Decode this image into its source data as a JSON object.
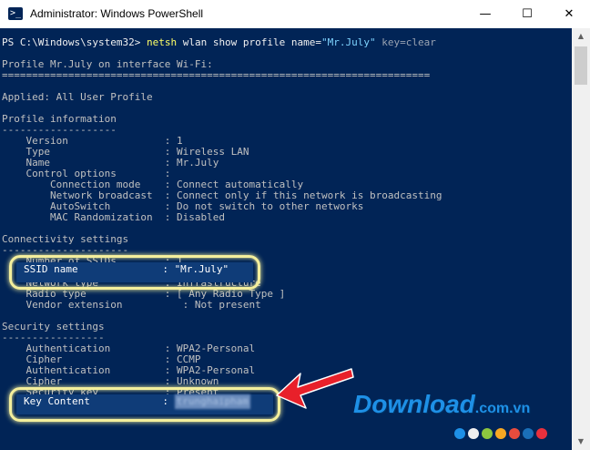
{
  "window": {
    "title": "Administrator: Windows PowerShell",
    "icon": "powershell-icon",
    "controls": {
      "minimize": "—",
      "maximize": "☐",
      "close": "✕"
    }
  },
  "console": {
    "prompt": "PS C:\\Windows\\system32>",
    "command": "netsh",
    "args": "wlan show profile name=",
    "arg_value": "\"Mr.July\"",
    "arg_tail": "key=clear",
    "lines": [
      "Profile Mr.July on interface Wi-Fi:",
      "=======================================================================",
      "Applied: All User Profile",
      "Profile information",
      "-------------------",
      "    Version                : 1",
      "    Type                   : Wireless LAN",
      "    Name                   : Mr.July",
      "    Control options        :",
      "        Connection mode    : Connect automatically",
      "        Network broadcast  : Connect only if this network is broadcasting",
      "        AutoSwitch         : Do not switch to other networks",
      "        MAC Randomization  : Disabled",
      "Connectivity settings",
      "---------------------",
      "    Number of SSIDs        : 1",
      "    Network type           : Infrastructure",
      "    Radio type             : [ Any Radio Type ]",
      "    Vendor extension          : Not present",
      "Security settings",
      "-----------------",
      "    Authentication         : WPA2-Personal",
      "    Cipher                 : CCMP",
      "    Authentication         : WPA2-Personal",
      "    Cipher                 : Unknown",
      "    Security key           : Present"
    ],
    "ssid_row": "SSID name              : \"Mr.July\"",
    "key_row_label": "Key Content            : ",
    "key_row_value": "trunghaipham"
  },
  "watermark": {
    "text": "Download",
    "suffix": ".com.vn"
  },
  "dot_colors": [
    "#1e90e6",
    "#f0f0f0",
    "#8cc63f",
    "#f7a823",
    "#e84c3d",
    "#1a6fb8",
    "#e8303d"
  ],
  "colors": {
    "console_bg": "#012456",
    "highlight": "#f4ef9c",
    "arrow": "#e8202a"
  }
}
